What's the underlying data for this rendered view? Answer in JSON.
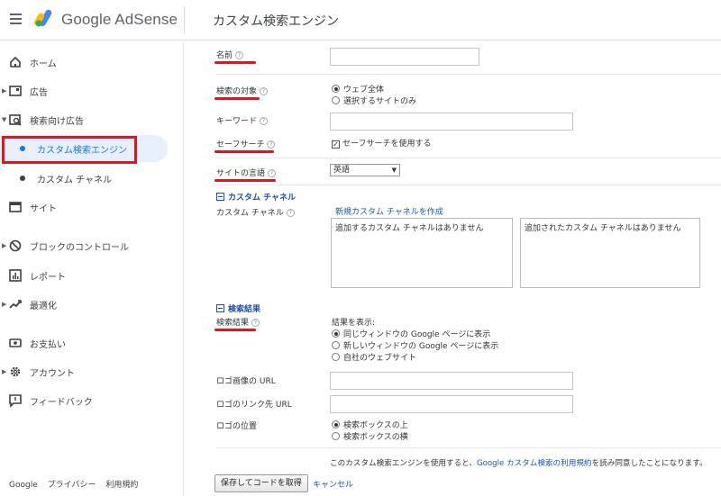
{
  "header": {
    "brand": "Google AdSense",
    "page_title": "カスタム検索エンジン"
  },
  "sidebar": {
    "items": [
      {
        "label": "ホーム",
        "icon": "home-icon"
      },
      {
        "label": "広告",
        "icon": "ads-icon"
      },
      {
        "label": "検索向け広告",
        "icon": "search-ads-icon"
      },
      {
        "label": "カスタム検索エンジン"
      },
      {
        "label": "カスタム チャネル"
      },
      {
        "label": "サイト",
        "icon": "sites-icon"
      },
      {
        "label": "ブロックのコントロール",
        "icon": "block-icon"
      },
      {
        "label": "レポート",
        "icon": "reports-icon"
      },
      {
        "label": "最適化",
        "icon": "optimize-icon"
      },
      {
        "label": "お支払い",
        "icon": "payments-icon"
      },
      {
        "label": "アカウント",
        "icon": "gear-icon"
      },
      {
        "label": "フィードバック",
        "icon": "feedback-icon"
      }
    ],
    "footer": [
      "Google",
      "プライバシー",
      "利用規約"
    ]
  },
  "form": {
    "name_label": "名前",
    "name_value": "",
    "search_target_label": "検索の対象",
    "search_target_options": [
      "ウェブ全体",
      "選択するサイトのみ"
    ],
    "search_target_selected": "ウェブ全体",
    "keyword_label": "キーワード",
    "keyword_value": "",
    "safesearch_label": "セーフサーチ",
    "safesearch_checkbox": "セーフサーチを使用する",
    "safesearch_checked": true,
    "language_label": "サイトの言語",
    "language_value": "英語",
    "custom_channel_section": "カスタム チャネル",
    "custom_channel_label": "カスタム チャネル",
    "create_channel_link": "新規カスタム チャネルを作成",
    "available_channels_empty": "追加するカスタム チャネルはありません",
    "added_channels_empty": "追加されたカスタム チャネルはありません",
    "results_section": "検索結果",
    "results_label": "検索結果",
    "results_display_label": "結果を表示:",
    "results_options": [
      "同じウィンドウの Google ページに表示",
      "新しいウィンドウの Google ページに表示",
      "自社のウェブサイト"
    ],
    "results_selected": "同じウィンドウの Google ページに表示",
    "logo_url_label": "ロゴ画像の URL",
    "logo_url_value": "",
    "logo_link_label": "ロゴのリンク先 URL",
    "logo_link_value": "",
    "logo_position_label": "ロゴの位置",
    "logo_position_options": [
      "検索ボックスの上",
      "検索ボックスの横"
    ],
    "logo_position_selected": "検索ボックスの上",
    "terms_prefix": "このカスタム検索エンジンを使用すると、",
    "terms_link": "Google カスタム検索の利用規約",
    "terms_suffix": "を読み同意したことになります。",
    "save_button": "保存してコードを取得",
    "cancel_link": "キャンセル"
  },
  "colors": {
    "highlight_red": "#e5131c",
    "link_blue": "#1a56b0",
    "active_blue": "#1a73e8"
  }
}
